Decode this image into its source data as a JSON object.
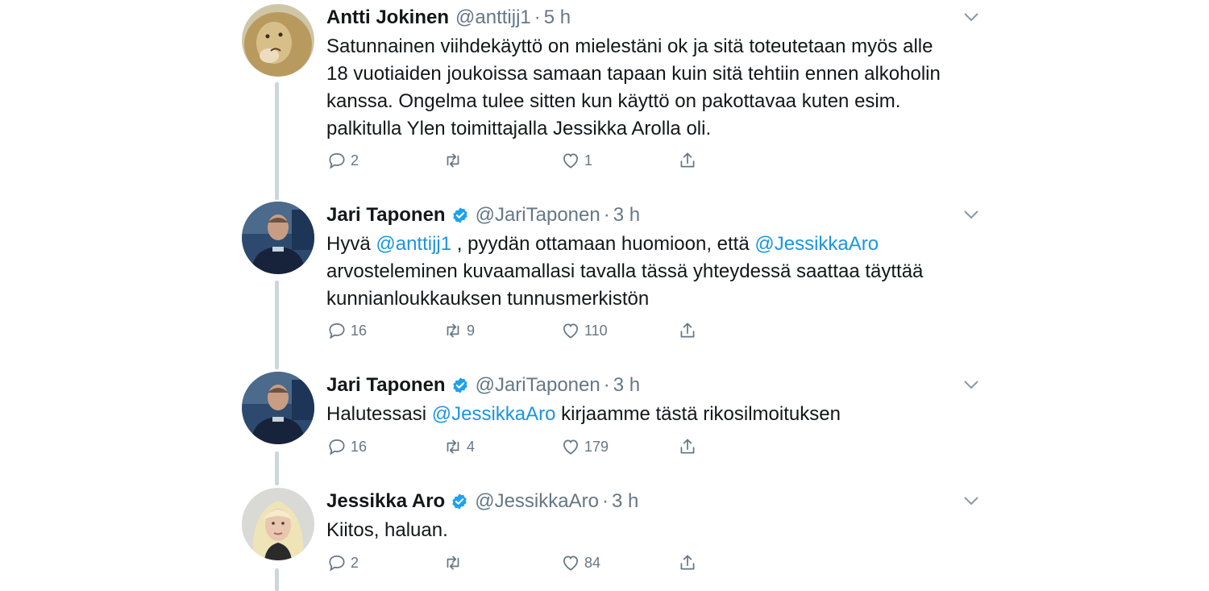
{
  "colors": {
    "link": "#1b95e0",
    "muted": "#657786",
    "thread_line": "#ccd6dd",
    "verified": "#1da1f2"
  },
  "tweets": [
    {
      "name": "Antti Jokinen",
      "handle": "@anttijj1",
      "time": "5 h",
      "verified": false,
      "avatar_icon": "lion-avatar",
      "text_lines": [
        "Satunnainen viihdekäyttö on mielestäni ok ja sitä toteutetaan myös alle",
        "18 vuotiaiden joukoissa samaan tapaan kuin sitä tehtiin ennen alkoholin",
        "kanssa. Ongelma tulee sitten kun käyttö on pakottavaa kuten esim.",
        "palkitulla Ylen toimittajalla Jessikka Arolla oli."
      ],
      "replies": "2",
      "retweets": "",
      "likes": "1"
    },
    {
      "name": "Jari Taponen",
      "handle": "@JariTaponen",
      "time": "3 h",
      "verified": true,
      "avatar_icon": "police-officer-avatar",
      "text_parts": {
        "l1_a": "Hyvä ",
        "l1_m1": "@anttijj1",
        "l1_b": " , pyydän ottamaan huomioon, että ",
        "l1_m2": "@JessikkaAro",
        "l2": "arvosteleminen kuvaamallasi tavalla tässä yhteydessä saattaa täyttää",
        "l3": "kunnianloukkauksen tunnusmerkistön"
      },
      "replies": "16",
      "retweets": "9",
      "likes": "110"
    },
    {
      "name": "Jari Taponen",
      "handle": "@JariTaponen",
      "time": "3 h",
      "verified": true,
      "avatar_icon": "police-officer-avatar",
      "text_parts": {
        "a": "Halutessasi ",
        "m": "@JessikkaAro",
        "b": " kirjaamme tästä rikosilmoituksen"
      },
      "replies": "16",
      "retweets": "4",
      "likes": "179"
    },
    {
      "name": "Jessikka Aro",
      "handle": "@JessikkaAro",
      "time": "3 h",
      "verified": true,
      "avatar_icon": "blonde-woman-avatar",
      "text_lines": [
        "Kiitos, haluan."
      ],
      "replies": "2",
      "retweets": "",
      "likes": "84"
    }
  ]
}
